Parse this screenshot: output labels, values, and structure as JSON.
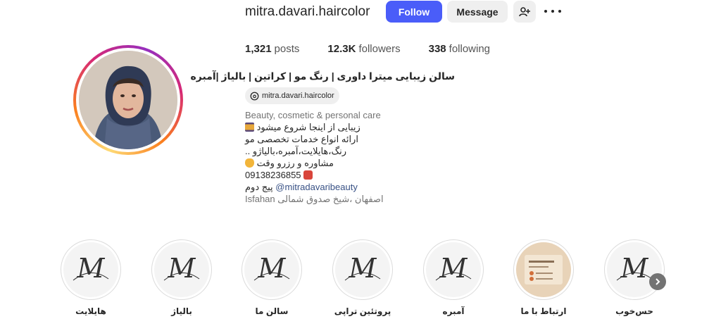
{
  "header": {
    "username": "mitra.davari.haircolor",
    "follow_label": "Follow",
    "message_label": "Message",
    "add_user_icon": "add-user-icon",
    "more_icon": "more-horizontal-icon"
  },
  "stats": {
    "posts_count": "1,321",
    "posts_label": "posts",
    "followers_count": "12.3K",
    "followers_label": "followers",
    "following_count": "338",
    "following_label": "following"
  },
  "bio": {
    "name": "سالن زیبایی میترا داوری | رنگ مو | کراتین | بالیاژ |آمبره",
    "threads_handle": "mitra.davari.haircolor",
    "category": "Beauty, cosmetic & personal care",
    "line1": "زیبایی از اینجا شروع میشود",
    "line2": "ارائه انواع خدمات تخصصی مو",
    "line3": "رنگ،هایلایت،آمبره،بالیاژو ..",
    "line4": "مشاوره و رزرو وقت",
    "phone": "09138236855",
    "second_page_label": "پیج دوم",
    "second_page_link": "@mitradavaribeauty",
    "location_fa": "اصفهان ،شیخ صدوق شمالی",
    "location_en": "Isfahan"
  },
  "highlights": [
    {
      "label": "هایلایت"
    },
    {
      "label": "بالیاژ"
    },
    {
      "label": "سالن ما"
    },
    {
      "label": "پروتئین تراپی"
    },
    {
      "label": "آمبره"
    },
    {
      "label": "ارتباط با ما"
    },
    {
      "label": "حس‌خوب"
    }
  ],
  "colors": {
    "accent": "#4a5df9",
    "text": "#262626",
    "muted": "#737373",
    "link": "#385185"
  }
}
